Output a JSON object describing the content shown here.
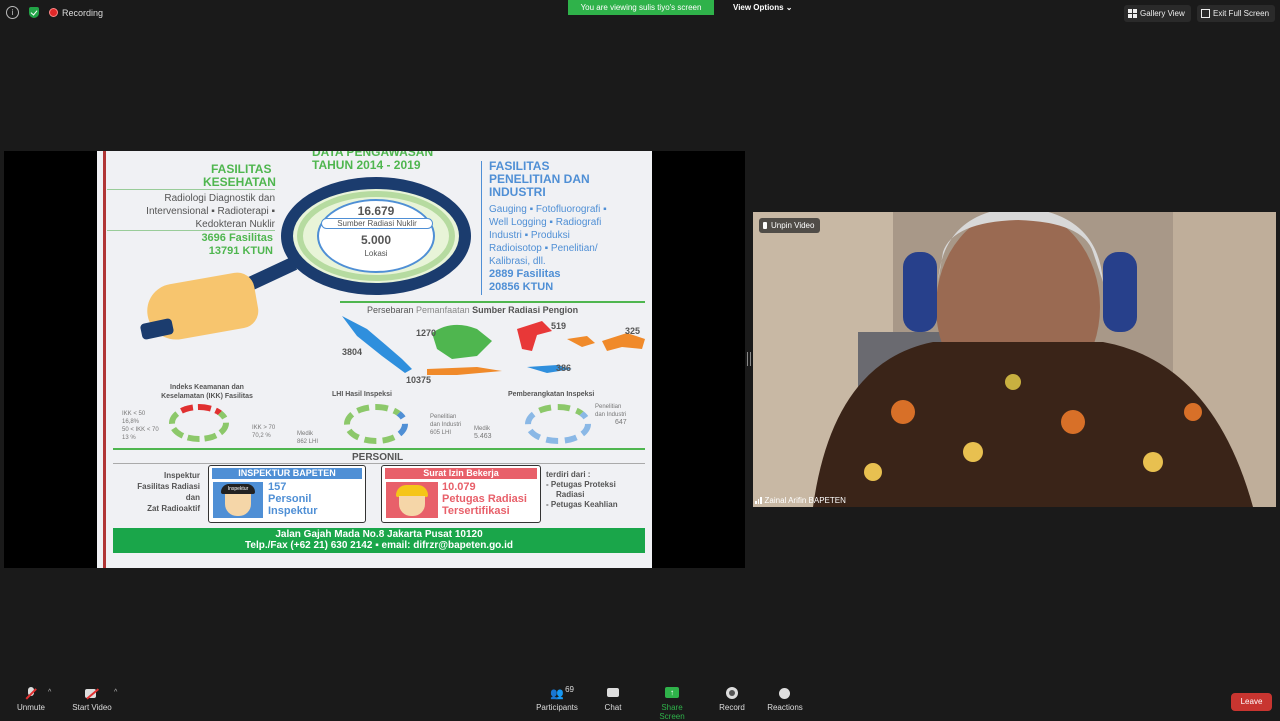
{
  "topbar": {
    "recording_label": "Recording",
    "viewing_banner": "You are viewing sulis tiyo's screen",
    "view_options": "View Options",
    "gallery_view": "Gallery View",
    "exit_full_screen": "Exit Full Screen"
  },
  "slide": {
    "header": "DATA PENGAWASAN",
    "subheader": "TAHUN 2014 - 2019",
    "health_title1": "FASILITAS",
    "health_title2": "KESEHATAN",
    "health_line1": "Radiologi Diagnostik dan",
    "health_line2": "Intervensional ▪ Radioterapi ▪",
    "health_line3": "Kedokteran Nuklir",
    "health_stat1": "3696 Fasilitas",
    "health_stat2": "13791 KTUN",
    "lens_number1": "16.679",
    "lens_label1": "Sumber Radiasi Nuklir",
    "lens_number2": "5.000",
    "lens_label2": "Lokasi",
    "industry_title1": "FASILITAS",
    "industry_title2": "PENELITIAN DAN",
    "industry_title3": "INDUSTRI",
    "industry_line1": "Gauging ▪ Fotofluorografi ▪",
    "industry_line2": "Well Logging ▪ Radiografi",
    "industry_line3": "Industri ▪ Produksi",
    "industry_line4": "Radioisotop ▪ Penelitian/",
    "industry_line5": "Kalibrasi, dll.",
    "industry_stat1": "2889 Fasilitas",
    "industry_stat2": "20856 KTUN",
    "map_title_a": "Persebaran",
    "map_title_b": "Pemanfaatan",
    "map_title_c": "Sumber Radiasi Pengion",
    "map_values": [
      "3804",
      "1270",
      "519",
      "325",
      "386",
      "10375"
    ],
    "ikk_title1": "Indeks Keamanan dan",
    "ikk_title2": "Keselamatan (IKK) Fasilitas",
    "ikk_l1": "IKK < 50",
    "ikk_l2": "16,8%",
    "ikk_l3": "50 < IKK < 70",
    "ikk_l4": "13 %",
    "ikk_r1": "IKK > 70",
    "ikk_r2": "70,2 %",
    "lhi_title": "LHI Hasil Inspeksi",
    "lhi_medik": "Medik",
    "lhi_medik_val": "862 LHI",
    "lhi_pen1": "Penelitian",
    "lhi_pen2": "dan Industri",
    "lhi_pen_val": "605 LHI",
    "pemb_title": "Pemberangkatan Inspeksi",
    "pemb_medik": "Medik",
    "pemb_medik_val": "5.463",
    "pemb_pen1": "Penelitian",
    "pemb_pen2": "dan Industri",
    "pemb_pen_val": "647",
    "personil": "PERSONIL",
    "insp_left1": "Inspektur",
    "insp_left2": "Fasilitas Radiasi",
    "insp_left3": "dan",
    "insp_left4": "Zat Radioaktif",
    "insp_box_title": "INSPEKTUR BAPETEN",
    "insp_badge": "Inspektur",
    "insp_num": "157",
    "insp_l1": "Personil",
    "insp_l2": "Inspektur",
    "sib_title": "Surat Izin Bekerja",
    "sib_num": "10.079",
    "sib_l1": "Petugas Radiasi",
    "sib_l2": "Tersertifikasi",
    "terdiri": "terdiri dari :",
    "terdiri1": "- Petugas Proteksi",
    "terdiri1b": "Radiasi",
    "terdiri2": "- Petugas Keahlian",
    "footer1": "Jalan Gajah Mada No.8 Jakarta Pusat 10120",
    "footer2": "Telp./Fax (+62 21) 630 2142 ▪ email: difrzr@bapeten.go.id"
  },
  "video": {
    "unpin": "Unpin Video",
    "name": "Zainal Arifin BAPETEN"
  },
  "toolbar": {
    "unmute": "Unmute",
    "start_video": "Start Video",
    "participants": "Participants",
    "participants_count": "69",
    "chat": "Chat",
    "share_screen": "Share Screen",
    "record": "Record",
    "reactions": "Reactions",
    "leave": "Leave"
  },
  "colors": {
    "zoom_green": "#2fb24a",
    "leave_red": "#c83530",
    "slide_green": "#4fb64f",
    "slide_blue": "#4f8fd5"
  }
}
